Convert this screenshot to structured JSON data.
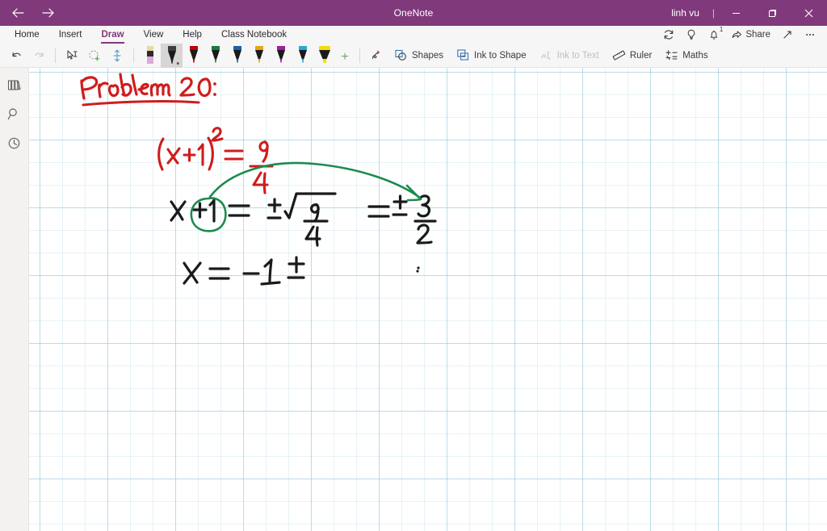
{
  "titlebar": {
    "back_label": "Back",
    "forward_label": "Forward",
    "app_title": "OneNote",
    "user_name": "linh vu",
    "separator": "|",
    "minimize_label": "Minimize",
    "restore_label": "Restore",
    "close_label": "Close",
    "background_color": "#80397b"
  },
  "menubar": {
    "tabs": [
      {
        "label": "Home",
        "active": false
      },
      {
        "label": "Insert",
        "active": false
      },
      {
        "label": "Draw",
        "active": true
      },
      {
        "label": "View",
        "active": false
      },
      {
        "label": "Help",
        "active": false
      },
      {
        "label": "Class Notebook",
        "active": false
      }
    ],
    "right_items": [
      {
        "name": "sync-icon",
        "label": ""
      },
      {
        "name": "lightbulb-icon",
        "label": ""
      },
      {
        "name": "notifications-bell-icon",
        "label": "",
        "badge": "1"
      },
      {
        "name": "share-button",
        "label": "Share"
      },
      {
        "name": "expand-icon",
        "label": ""
      },
      {
        "name": "more-options-icon",
        "label": ""
      }
    ],
    "active_tab_color": "#80397b"
  },
  "ribbon": {
    "undo_label": "Undo",
    "redo_label": "Redo",
    "select_type_label": "Type",
    "lasso_select_label": "Lasso Select",
    "insert_space_label": "Insert Space",
    "pens": [
      {
        "name": "eraser-pen",
        "color": "#d9a9d9",
        "cap": "#e8d9a0",
        "selected": false
      },
      {
        "name": "pen-black",
        "color": "#1a1a1a",
        "cap": "#888888",
        "selected": true
      },
      {
        "name": "pen-red",
        "color": "#c00000",
        "cap": "#c00000",
        "selected": false
      },
      {
        "name": "pen-green",
        "color": "#108040",
        "cap": "#108040",
        "selected": false
      },
      {
        "name": "pen-blue",
        "color": "#1f5fa8",
        "cap": "#1f5fa8",
        "selected": false
      },
      {
        "name": "pen-yellow",
        "color": "#e8a317",
        "cap": "#e8a317",
        "selected": false
      },
      {
        "name": "pen-magenta",
        "color": "#a61ba6",
        "cap": "#a61ba6",
        "selected": false
      },
      {
        "name": "pen-cyan",
        "color": "#28a8d8",
        "cap": "#28a8d8",
        "selected": false
      },
      {
        "name": "highlighter-yellow",
        "color": "#f5dd00",
        "cap": "#f5dd00",
        "selected": false
      }
    ],
    "add_pen_label": "+",
    "tools": [
      {
        "name": "ink-replay",
        "label": "",
        "disabled": false
      },
      {
        "name": "shapes-button",
        "label": "Shapes",
        "disabled": false
      },
      {
        "name": "ink-to-shape-button",
        "label": "Ink to Shape",
        "disabled": false
      },
      {
        "name": "ink-to-text-button",
        "label": "Ink to Text",
        "disabled": true
      },
      {
        "name": "ruler-button",
        "label": "Ruler",
        "disabled": false
      },
      {
        "name": "maths-button",
        "label": "Maths",
        "disabled": false
      }
    ]
  },
  "rail": {
    "items": [
      {
        "name": "notebooks-icon",
        "label": "Notebooks"
      },
      {
        "name": "search-icon",
        "label": "Search"
      },
      {
        "name": "recent-notes-icon",
        "label": "Recent Notes"
      }
    ]
  },
  "page": {
    "background": "graph-grid",
    "grid_color": "#96c8da",
    "ink_notes": [
      {
        "name": "heading-problem-20",
        "text": "Problem 20 :",
        "color": "#d01c1c",
        "underlined": true
      },
      {
        "name": "equation-line-1",
        "text": "(x + 1)^2 = 9/4",
        "color": "#d01c1c"
      },
      {
        "name": "equation-line-2",
        "text": "x + 1 = ± sqrt(9/4) = ± 3/2",
        "color": "#1a1a1a"
      },
      {
        "name": "equation-line-3",
        "text": "x = -1 ±",
        "color": "#1a1a1a"
      },
      {
        "name": "annotation-circle-plus-one",
        "text": "circle around +1",
        "color": "#1d8a4e"
      },
      {
        "name": "annotation-arrow",
        "text": "curved arrow from (x+1) to right side",
        "color": "#1d8a4e"
      }
    ]
  }
}
